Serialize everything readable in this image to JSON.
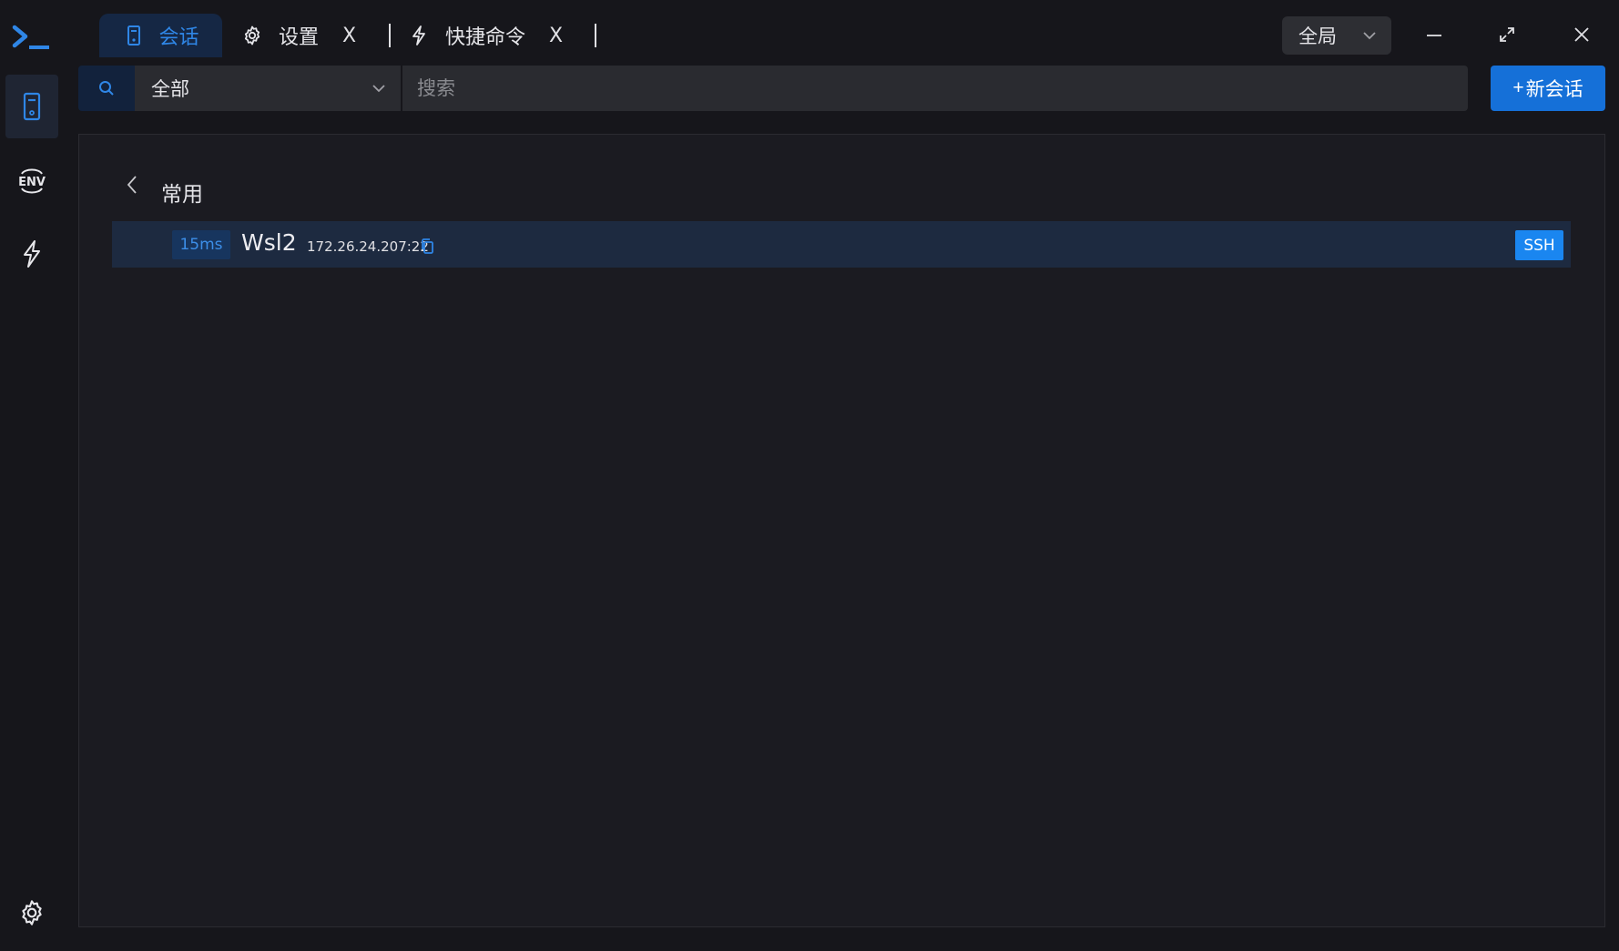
{
  "app": {
    "logo_icon": "terminal-prompt-icon",
    "accent_color": "#1570d8"
  },
  "tabs": [
    {
      "label": "会话",
      "icon": "session-icon",
      "active": true,
      "closable": false
    },
    {
      "label": "设置",
      "icon": "gear-icon",
      "active": false,
      "closable": true,
      "close_label": "X"
    },
    {
      "label": "快捷命令",
      "icon": "lightning-icon",
      "active": false,
      "closable": true,
      "close_label": "X"
    }
  ],
  "scope": {
    "selected": "全局"
  },
  "sidebar": {
    "items": [
      {
        "name": "sessions",
        "icon": "session-icon",
        "active": true
      },
      {
        "name": "env",
        "icon": "env-icon",
        "active": false
      },
      {
        "name": "quick-commands",
        "icon": "lightning-icon",
        "active": false
      }
    ],
    "settings_icon": "gear-icon"
  },
  "toolbar": {
    "group_selected": "全部",
    "search_placeholder": "搜索",
    "new_session_label": "新会话",
    "new_session_prefix": "+"
  },
  "group": {
    "title": "常用",
    "sessions": [
      {
        "latency": "15ms",
        "name": "Wsl2",
        "address": "172.26.24.207:22",
        "protocol": "SSH"
      }
    ]
  }
}
